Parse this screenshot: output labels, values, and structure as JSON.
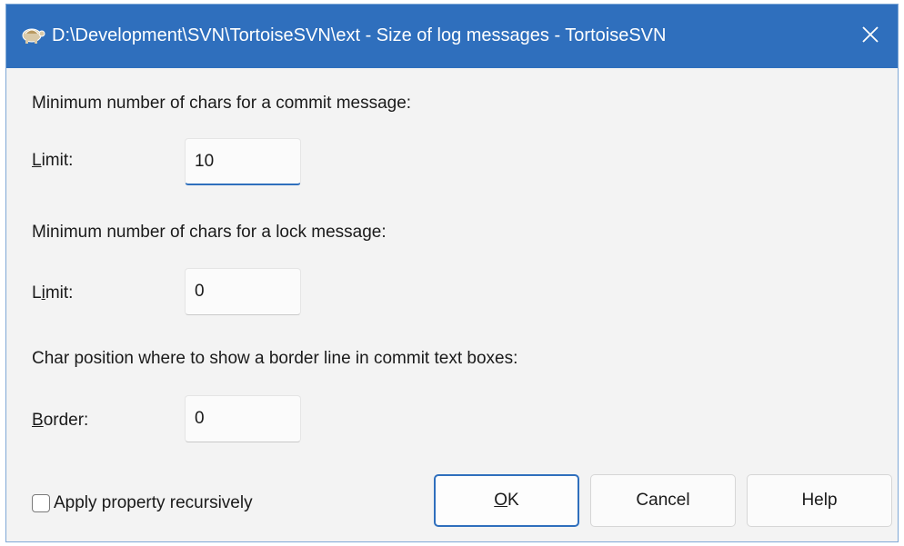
{
  "window": {
    "title": "D:\\Development\\SVN\\TortoiseSVN\\ext - Size of log messages - TortoiseSVN",
    "app_icon": "tortoise-icon",
    "close_icon": "close-icon"
  },
  "commit": {
    "heading": "Minimum number of chars for a commit message:",
    "label_mnemonic": "L",
    "label_rest": "imit:",
    "value": "10"
  },
  "lock": {
    "heading": "Minimum number of chars for a lock message:",
    "label_pre": "L",
    "label_mnemonic": "i",
    "label_rest": "mit:",
    "value": "0"
  },
  "border": {
    "heading": "Char position where to show a border line in commit text boxes:",
    "label_mnemonic": "B",
    "label_rest": "order:",
    "value": "0"
  },
  "recursive": {
    "label": "Apply property recursively",
    "checked": false
  },
  "buttons": {
    "ok_mnemonic": "O",
    "ok_rest": "K",
    "cancel": "Cancel",
    "help": "Help"
  },
  "colors": {
    "titlebar": "#2f6fbd",
    "accent": "#2f6fbd",
    "dialog_bg": "#f3f3f3"
  }
}
